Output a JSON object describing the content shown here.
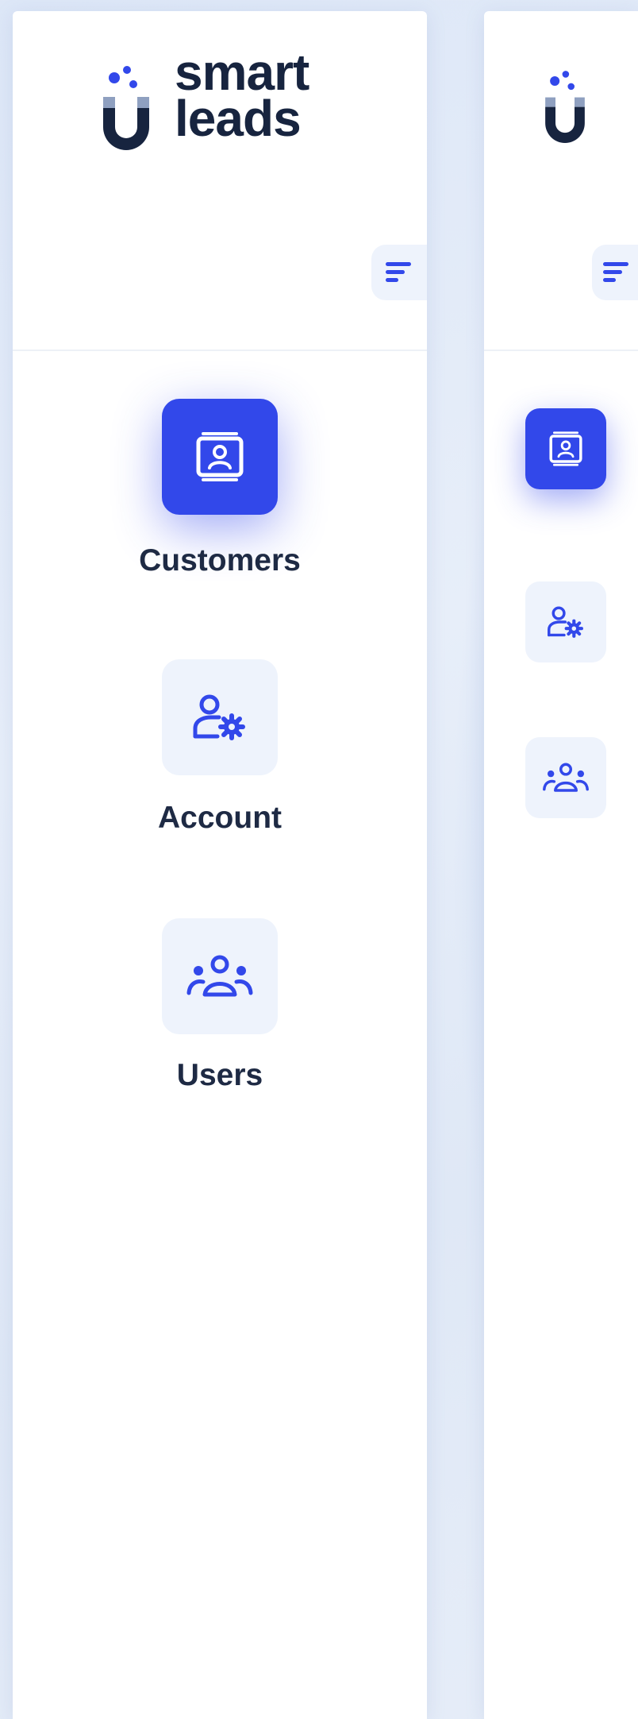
{
  "brand": {
    "line1": "smart",
    "line2": "leads"
  },
  "sidebar": {
    "items": [
      {
        "label": "Customers",
        "icon": "contact-card-icon",
        "active": true
      },
      {
        "label": "Account",
        "icon": "user-settings-icon",
        "active": false
      },
      {
        "label": "Users",
        "icon": "users-group-icon",
        "active": false
      }
    ],
    "toggle_icon": "menu-lines-icon"
  },
  "colors": {
    "accent": "#3248ea",
    "brand_dark": "#17243f",
    "icon_bg": "#eef3fc",
    "label": "#1e2a44",
    "background": "#e2eaf7"
  }
}
